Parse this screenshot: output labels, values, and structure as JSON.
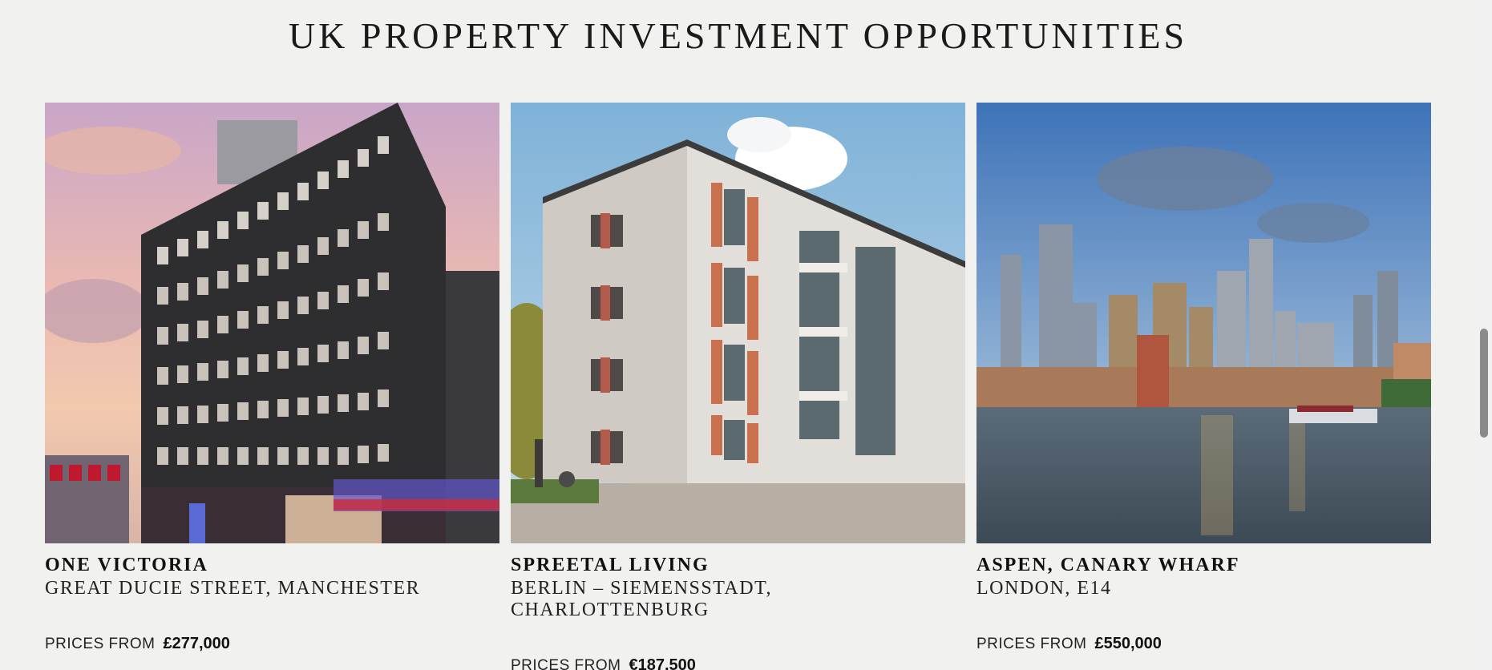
{
  "page": {
    "heading": "UK PROPERTY INVESTMENT OPPORTUNITIES"
  },
  "cards": [
    {
      "name": "ONE VICTORIA",
      "location": "GREAT DUCIE STREET, MANCHESTER",
      "price_label": "PRICES FROM",
      "price_value": "£277,000",
      "image_icon": "building-photo"
    },
    {
      "name": "SPREETAL LIVING",
      "location": "BERLIN – SIEMENSSTADT, CHARLOTTENBURG",
      "price_label": "PRICES FROM",
      "price_value": "€187,500",
      "image_icon": "apartment-photo"
    },
    {
      "name": "ASPEN, CANARY WHARF",
      "location": "LONDON, E14",
      "price_label": "PRICES FROM",
      "price_value": "£550,000",
      "image_icon": "skyline-photo"
    }
  ],
  "colors": {
    "background": "#f1f1ef",
    "text": "#1a1a1a"
  }
}
